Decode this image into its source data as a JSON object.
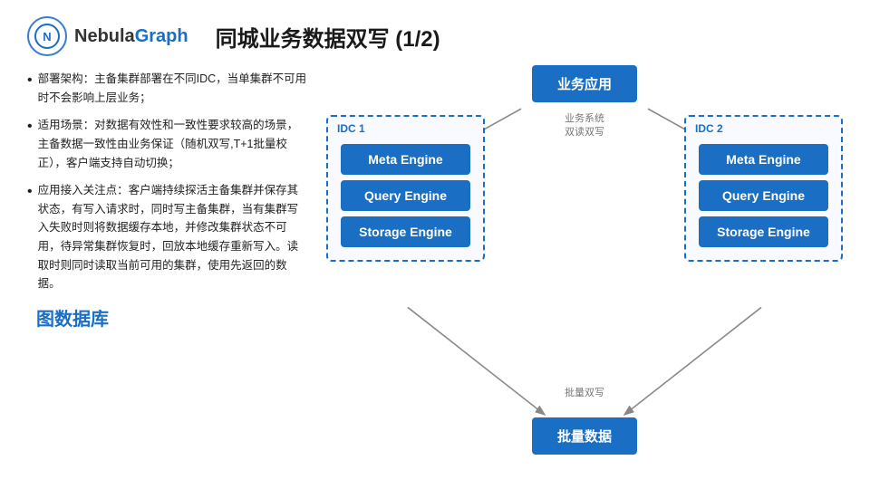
{
  "header": {
    "logo_text_nebula": "Nebula",
    "logo_text_graph": "Graph",
    "title": "同城业务数据双写 (1/2)"
  },
  "left": {
    "bullets": [
      "部署架构：主备集群部署在不同IDC，当单集群不可用时不会影响上层业务；",
      "适用场景：对数据有效性和一致性要求较高的场景，主备数据一致性由业务保证（随机双写,T+1批量校正），客户端支持自动切换；",
      "应用接入关注点：客户端持续探活主备集群并保存其状态，有写入请求时，同时写主备集群，当有集群写入失败时则将数据缓存本地，并修改集群状态不可用，待异常集群恢复时，回放本地缓存重新写入。读取时则同时读取当前可用的集群，使用先返回的数据。"
    ],
    "graph_db_label": "图数据库"
  },
  "diagram": {
    "biz_app": "业务应用",
    "batch_data": "批量数据",
    "idc1_label": "IDC 1",
    "idc2_label": "IDC 2",
    "engines": [
      "Meta Engine",
      "Query Engine",
      "Storage Engine"
    ],
    "annotation_top": "业务系统\n双读双写",
    "annotation_bottom": "批量双写"
  }
}
